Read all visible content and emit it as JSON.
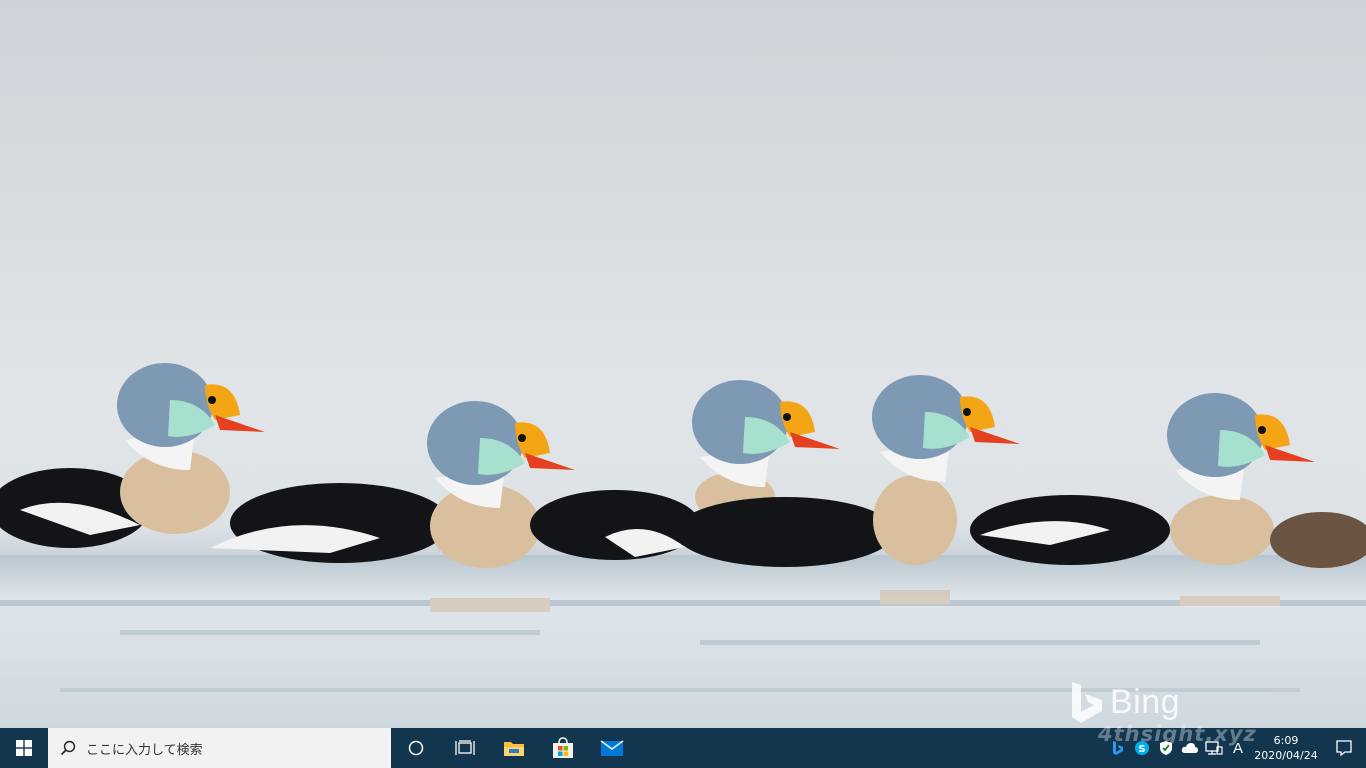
{
  "wallpaper": {
    "description_icon": "king-eider-ducks-photo",
    "watermark_text": "Bing"
  },
  "taskbar": {
    "start_icon": "windows-logo-icon",
    "search": {
      "icon": "search-icon",
      "placeholder": "ここに入力して検索"
    },
    "items": [
      {
        "name": "cortana",
        "icon": "circle-icon"
      },
      {
        "name": "task-view",
        "icon": "task-view-icon"
      },
      {
        "name": "file-explorer",
        "icon": "folder-icon"
      },
      {
        "name": "microsoft-store",
        "icon": "store-bag-icon"
      },
      {
        "name": "mail",
        "icon": "envelope-icon"
      }
    ],
    "tray": {
      "icons": [
        "bing-icon",
        "skype-icon",
        "defender-shield-icon",
        "onedrive-cloud-icon",
        "network-icon"
      ],
      "ime_label": "A",
      "time": "6:09",
      "date": "2020/04/24",
      "notification_icon": "action-center-icon"
    }
  },
  "site_watermark": "4thsight.xyz",
  "colors": {
    "taskbar": "#13364f",
    "search_bg": "#f2f2f2",
    "store_accent": "#f25022",
    "mail_accent": "#0078d7",
    "folder_accent": "#f9c03e"
  }
}
